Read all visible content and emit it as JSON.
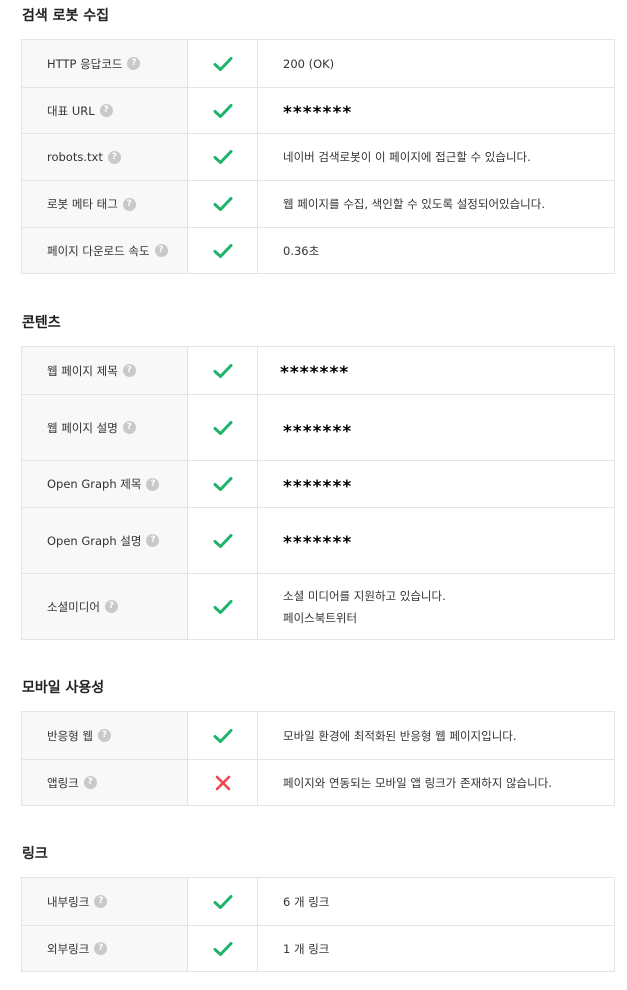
{
  "colors": {
    "ok": "#1fb36a",
    "fail": "#f0464b"
  },
  "help_glyph": "?",
  "crawl": {
    "title": "검색 로봇 수집",
    "rows": [
      {
        "label": "HTTP 응답코드",
        "status": "ok",
        "value": "200 (OK)"
      },
      {
        "label": "대표 URL",
        "status": "ok",
        "value": "*******"
      },
      {
        "label": "robots.txt",
        "status": "ok",
        "value": "네이버 검색로봇이 이 페이지에 접근할 수 있습니다."
      },
      {
        "label": "로봇 메타 태그",
        "status": "ok",
        "value": "웹 페이지를 수집, 색인할 수 있도록 설정되어있습니다."
      },
      {
        "label": "페이지 다운로드 속도",
        "status": "ok",
        "value": "0.36초"
      }
    ]
  },
  "content": {
    "title": "콘텐츠",
    "rows": [
      {
        "label": "웹 페이지 제목",
        "status": "ok",
        "value": "*******"
      },
      {
        "label": "웹 페이지 설명",
        "status": "ok",
        "value": "*******"
      },
      {
        "label": "Open Graph 제목",
        "status": "ok",
        "value": "*******"
      },
      {
        "label": "Open Graph 설명",
        "status": "ok",
        "value": "*******"
      },
      {
        "label": "소셜미디어",
        "status": "ok",
        "value": "소셜 미디어를 지원하고 있습니다.",
        "value2": "페이스북트위터"
      }
    ]
  },
  "mobile": {
    "title": "모바일 사용성",
    "rows": [
      {
        "label": "반응형 웹",
        "status": "ok",
        "value": "모바일 환경에 최적화된 반응형 웹 페이지입니다."
      },
      {
        "label": "앱링크",
        "status": "fail",
        "value": "페이지와 연동되는 모바일 앱 링크가 존재하지 않습니다."
      }
    ]
  },
  "links": {
    "title": "링크",
    "rows": [
      {
        "label": "내부링크",
        "status": "ok",
        "value": "6 개 링크"
      },
      {
        "label": "외부링크",
        "status": "ok",
        "value": "1 개 링크"
      }
    ]
  }
}
